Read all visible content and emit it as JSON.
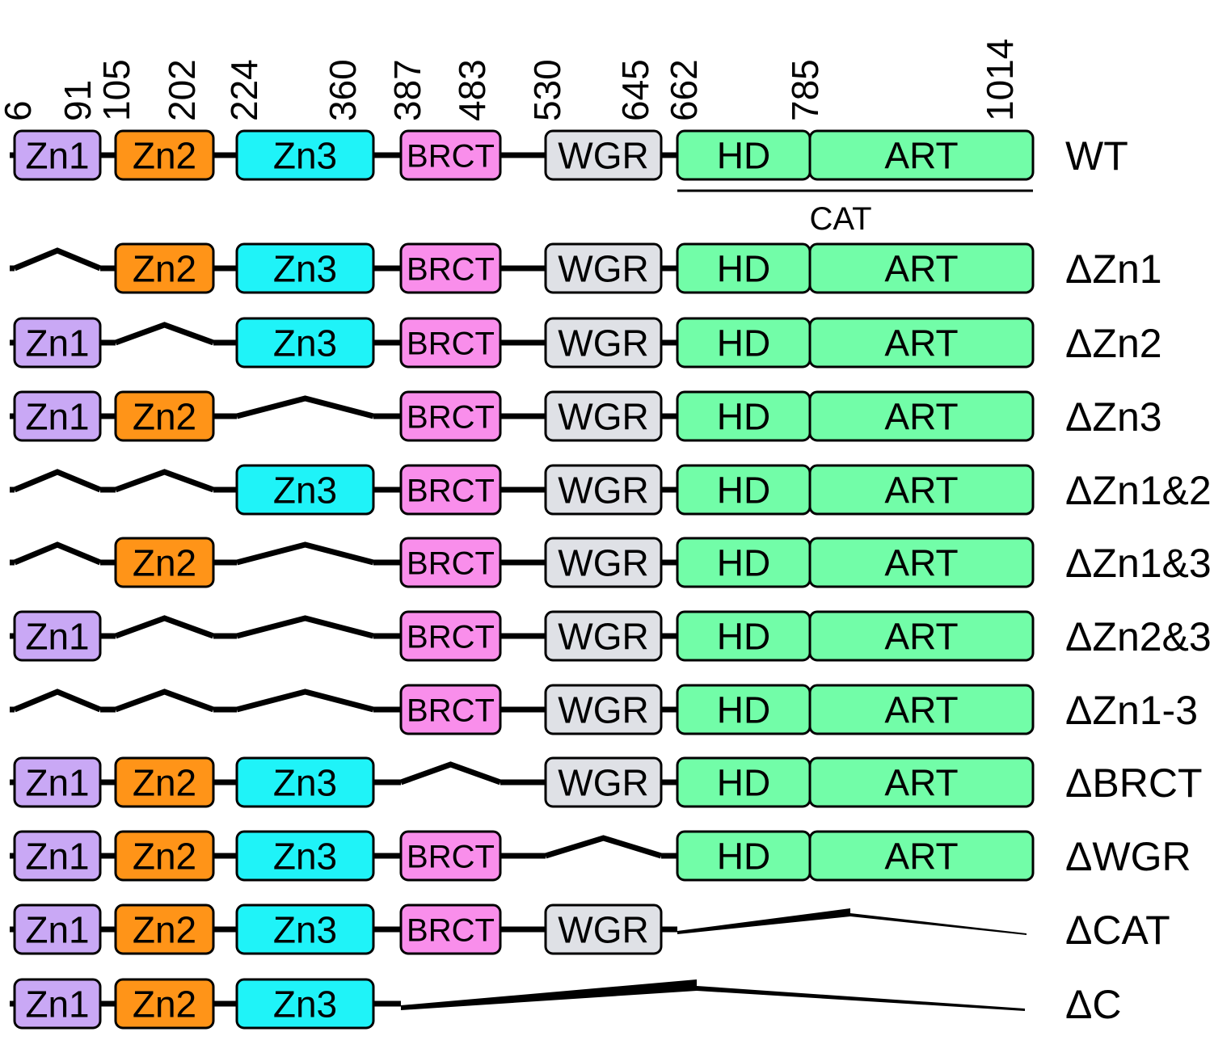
{
  "positions": [
    "6",
    "91",
    "105",
    "202",
    "224",
    "360",
    "387",
    "483",
    "530",
    "645",
    "662",
    "785",
    "1014"
  ],
  "domains": {
    "Zn1": {
      "label": "Zn1",
      "color": "#c9a8f5"
    },
    "Zn2": {
      "label": "Zn2",
      "color": "#ff9418"
    },
    "Zn3": {
      "label": "Zn3",
      "color": "#1ff3f8"
    },
    "BRCT": {
      "label": "BRCT",
      "color": "#f98eeb"
    },
    "WGR": {
      "label": "WGR",
      "color": "#dfe1e6"
    },
    "HD": {
      "label": "HD",
      "color": "#72fda8"
    },
    "ART": {
      "label": "ART",
      "color": "#72fda8"
    }
  },
  "cat_label": "CAT",
  "constructs": [
    {
      "label": "WT",
      "deleted": []
    },
    {
      "label": "ΔZn1",
      "deleted": [
        "Zn1"
      ]
    },
    {
      "label": "ΔZn2",
      "deleted": [
        "Zn2"
      ]
    },
    {
      "label": "ΔZn3",
      "deleted": [
        "Zn3"
      ]
    },
    {
      "label": "ΔZn1&2",
      "deleted": [
        "Zn1",
        "Zn2"
      ]
    },
    {
      "label": "ΔZn1&3",
      "deleted": [
        "Zn1",
        "Zn3"
      ]
    },
    {
      "label": "ΔZn2&3",
      "deleted": [
        "Zn2",
        "Zn3"
      ]
    },
    {
      "label": "ΔZn1-3",
      "deleted": [
        "Zn1",
        "Zn2",
        "Zn3"
      ]
    },
    {
      "label": "ΔBRCT",
      "deleted": [
        "BRCT"
      ]
    },
    {
      "label": "ΔWGR",
      "deleted": [
        "WGR"
      ]
    },
    {
      "label": "ΔCAT",
      "deleted": [
        "HD",
        "ART"
      ]
    },
    {
      "label": "ΔC",
      "deleted": [
        "BRCT",
        "WGR",
        "HD",
        "ART"
      ]
    }
  ]
}
